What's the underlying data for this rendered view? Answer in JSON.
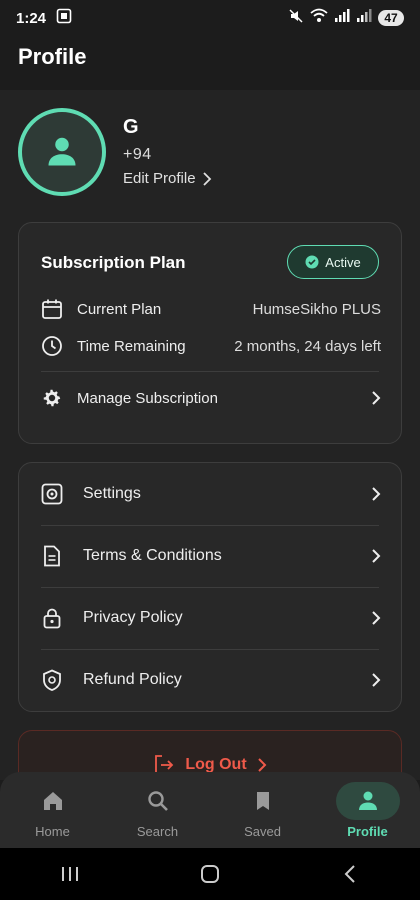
{
  "status": {
    "time": "1:24",
    "battery": "47"
  },
  "page": {
    "title": "Profile"
  },
  "profile": {
    "name": "G",
    "phone": "+94",
    "edit_label": "Edit Profile"
  },
  "subscription": {
    "title": "Subscription Plan",
    "status": "Active",
    "rows": [
      {
        "label": "Current Plan",
        "value": "HumseSikho PLUS"
      },
      {
        "label": "Time Remaining",
        "value": "2 months, 24 days left"
      }
    ],
    "manage_label": "Manage Subscription"
  },
  "links": [
    {
      "label": "Settings"
    },
    {
      "label": "Terms & Conditions"
    },
    {
      "label": "Privacy Policy"
    },
    {
      "label": "Refund Policy"
    }
  ],
  "logout": {
    "label": "Log Out"
  },
  "nav": [
    {
      "label": "Home",
      "icon": "home-icon"
    },
    {
      "label": "Search",
      "icon": "search-icon"
    },
    {
      "label": "Saved",
      "icon": "bookmark-icon"
    },
    {
      "label": "Profile",
      "icon": "person-icon"
    }
  ],
  "colors": {
    "accent": "#5fdcb3",
    "danger": "#ef5a4a",
    "background": "#1c1c1c",
    "card": "#282828"
  }
}
